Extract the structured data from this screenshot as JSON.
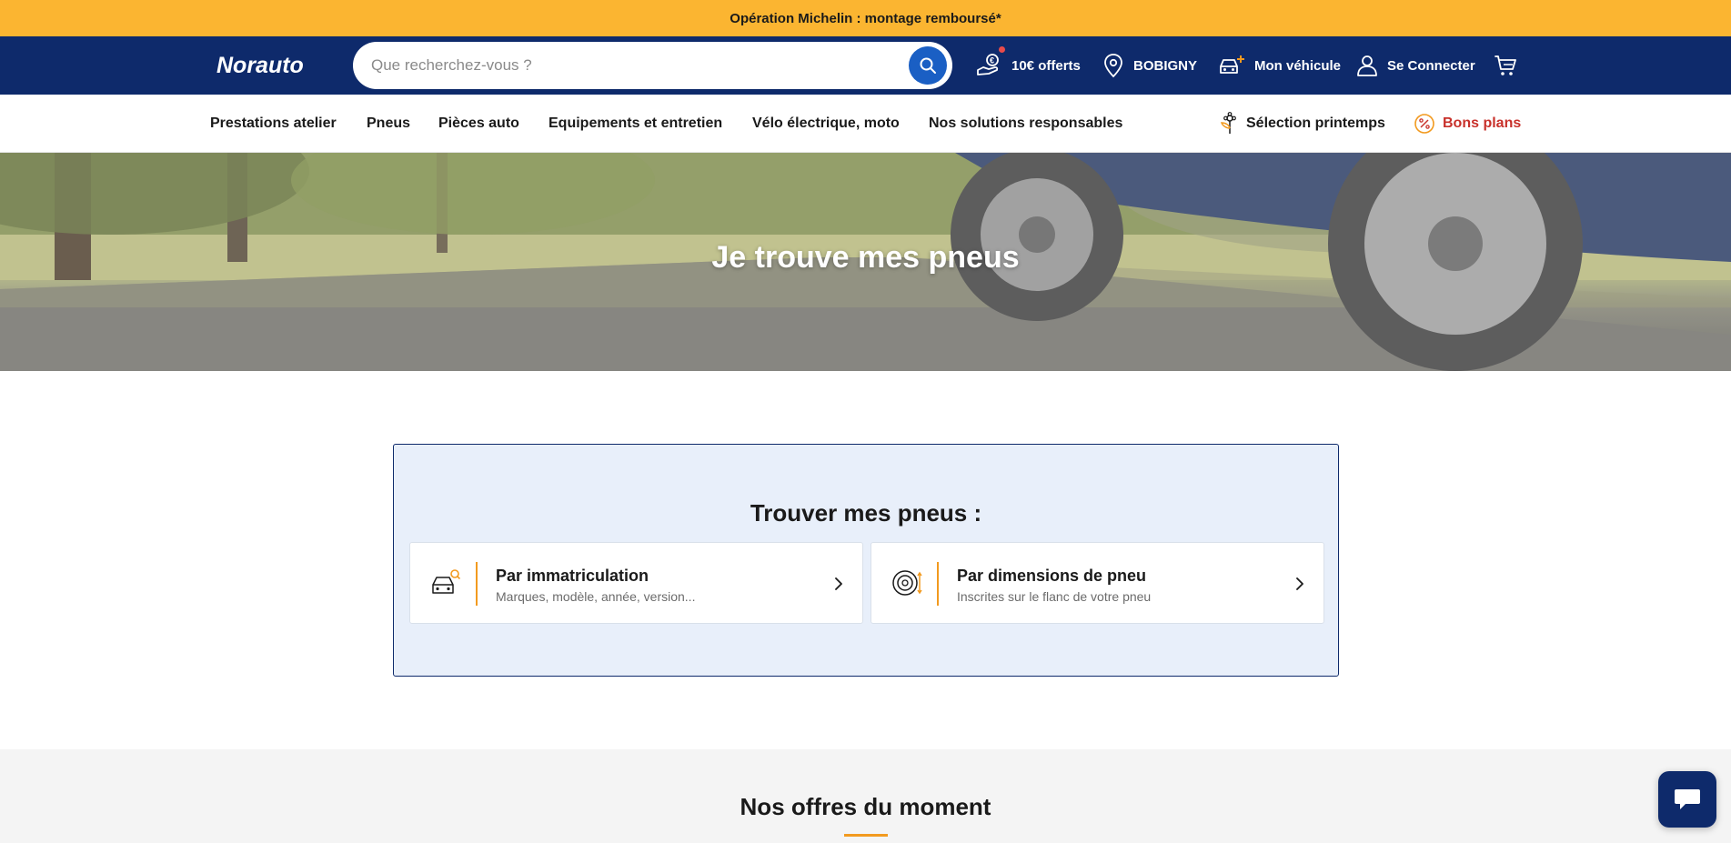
{
  "promo": {
    "text": "Opération Michelin : montage remboursé*"
  },
  "header": {
    "brand": "Norauto",
    "search": {
      "placeholder": "Que recherchez-vous ?",
      "value": ""
    },
    "offers_label": "10€ offerts",
    "store_label": "BOBIGNY",
    "vehicle_label": "Mon véhicule",
    "login_label": "Se Connecter"
  },
  "nav": {
    "items": [
      {
        "label": "Prestations atelier"
      },
      {
        "label": "Pneus"
      },
      {
        "label": "Pièces auto"
      },
      {
        "label": "Equipements et entretien"
      },
      {
        "label": "Vélo électrique, moto"
      },
      {
        "label": "Nos solutions responsables"
      }
    ],
    "spring_label": "Sélection printemps",
    "deals_label": "Bons plans"
  },
  "hero": {
    "title": "Je trouve mes pneus"
  },
  "finder": {
    "title": "Trouver mes pneus :",
    "cards": [
      {
        "title": "Par immatriculation",
        "subtitle": "Marques, modèle, année, version..."
      },
      {
        "title": "Par dimensions de pneu",
        "subtitle": "Inscrites sur le flanc de votre pneu"
      }
    ]
  },
  "offers": {
    "title": "Nos offres du moment"
  },
  "colors": {
    "promo_bg": "#fbb531",
    "header_bg": "#0e2a6b",
    "search_button": "#1a5fc4",
    "accent_orange": "#f29a1f",
    "deals_red": "#c8312b",
    "finder_bg": "#e8effa"
  }
}
